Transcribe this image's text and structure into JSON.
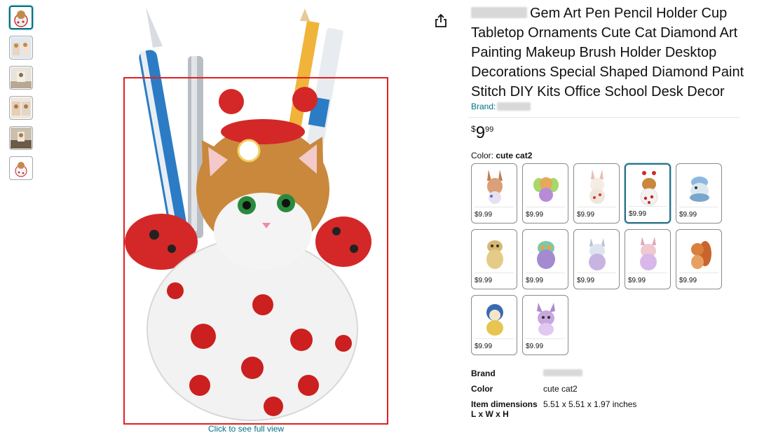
{
  "thumbnails": [
    {
      "id": "thumb-1",
      "selected": true
    },
    {
      "id": "thumb-2",
      "selected": false
    },
    {
      "id": "thumb-3",
      "selected": false
    },
    {
      "id": "thumb-4",
      "selected": false
    },
    {
      "id": "thumb-5",
      "selected": false
    },
    {
      "id": "thumb-6",
      "selected": false
    }
  ],
  "main_image": {
    "click_hint": "Click to see full view"
  },
  "product": {
    "title_rest": "Gem Art Pen Pencil Holder Cup Tabletop Ornaments Cute Cat Diamond Art Painting Makeup Brush Holder Desktop Decorations Special Shaped Diamond Paint Stitch DIY Kits Office School Desk Decor",
    "brand_prefix": "Brand:",
    "price_symbol": "$",
    "price_whole": "9",
    "price_fraction": "99",
    "color_label": "Color:",
    "color_value": "cute cat2"
  },
  "swatches": [
    {
      "price": "$9.99",
      "selected": false
    },
    {
      "price": "$9.99",
      "selected": false
    },
    {
      "price": "$9.99",
      "selected": false
    },
    {
      "price": "$9.99",
      "selected": true
    },
    {
      "price": "$9.99",
      "selected": false
    },
    {
      "price": "$9.99",
      "selected": false
    },
    {
      "price": "$9.99",
      "selected": false
    },
    {
      "price": "$9.99",
      "selected": false
    },
    {
      "price": "$9.99",
      "selected": false
    },
    {
      "price": "$9.99",
      "selected": false
    },
    {
      "price": "$9.99",
      "selected": false
    },
    {
      "price": "$9.99",
      "selected": false
    }
  ],
  "specs": {
    "brand_key": "Brand",
    "color_key": "Color",
    "color_val": "cute cat2",
    "dims_key": "Item dimensions",
    "dims_key_sub": "L x W x H",
    "dims_val": "5.51 x 5.51 x 1.97 inches"
  },
  "colors": {
    "link": "#007185",
    "highlight_box": "#e02020",
    "selected_swatch": "#2a6f85"
  }
}
